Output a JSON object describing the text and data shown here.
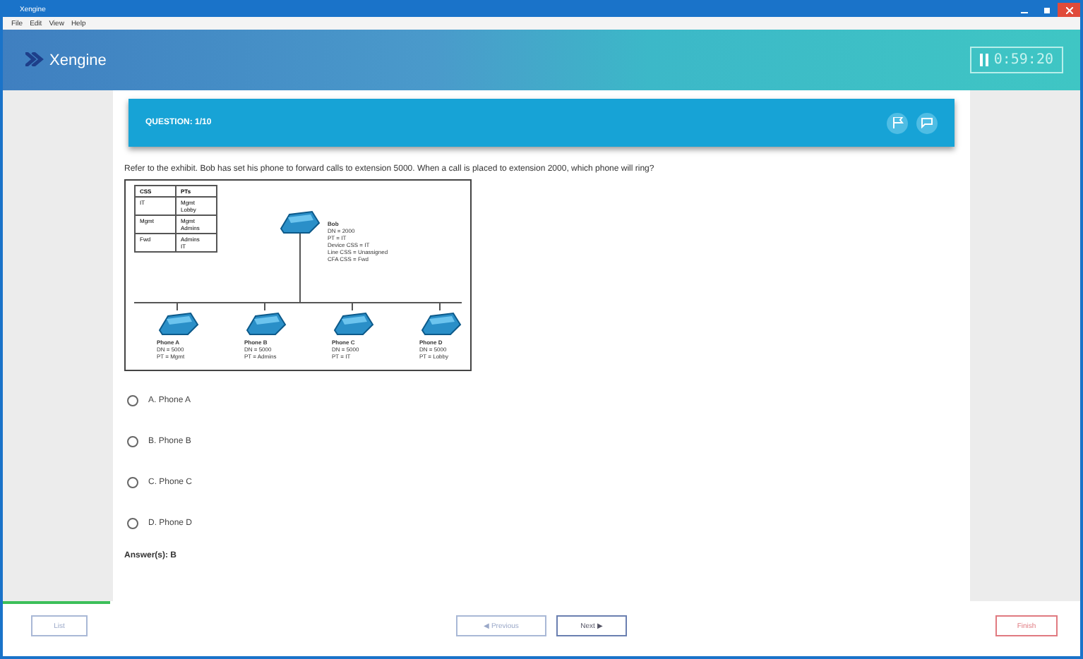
{
  "window": {
    "title": "Xengine",
    "menu": [
      "File",
      "Edit",
      "View",
      "Help"
    ]
  },
  "header": {
    "logo": "Xengine",
    "timer": "0:59:20"
  },
  "question": {
    "title": "QUESTION: 1/10",
    "text": "Refer to the exhibit. Bob has set his phone to forward calls to extension 5000. When a call is placed to extension 2000, which phone will ring?"
  },
  "exhibit": {
    "table": {
      "columns": [
        "CSS",
        "PTs"
      ],
      "rows": [
        [
          "IT",
          "Mgmt\nLobby"
        ],
        [
          "Mgmt",
          "Mgmt\nAdmins"
        ],
        [
          "Fwd",
          "Admins\nIT"
        ]
      ]
    },
    "bob": {
      "name": "Bob",
      "lines": [
        "DN = 2000",
        "PT = IT",
        "Device CSS = IT",
        "Line CSS = Unassigned",
        "CFA CSS = Fwd"
      ]
    },
    "phones": [
      {
        "name": "Phone A",
        "lines": [
          "DN = 5000",
          "PT = Mgmt"
        ]
      },
      {
        "name": "Phone B",
        "lines": [
          "DN = 5000",
          "PT = Admins"
        ]
      },
      {
        "name": "Phone C",
        "lines": [
          "DN = 5000",
          "PT = IT"
        ]
      },
      {
        "name": "Phone D",
        "lines": [
          "DN = 5000",
          "PT = Lobby"
        ]
      }
    ]
  },
  "options": [
    {
      "label": "A. Phone A",
      "selected": false
    },
    {
      "label": "B. Phone B",
      "selected": false
    },
    {
      "label": "C. Phone C",
      "selected": false
    },
    {
      "label": "D. Phone D",
      "selected": false
    }
  ],
  "answer": "Answer(s): B",
  "progress": {
    "level": 0.1
  },
  "footer": {
    "left": "List",
    "previous": "◀ Previous",
    "next": "Next ▶",
    "right": "Finish"
  }
}
